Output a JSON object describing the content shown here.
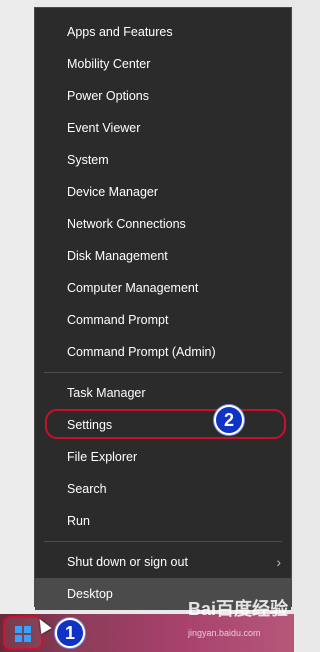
{
  "menu": {
    "items": [
      {
        "label": "Apps and Features"
      },
      {
        "label": "Mobility Center"
      },
      {
        "label": "Power Options"
      },
      {
        "label": "Event Viewer"
      },
      {
        "label": "System"
      },
      {
        "label": "Device Manager"
      },
      {
        "label": "Network Connections"
      },
      {
        "label": "Disk Management"
      },
      {
        "label": "Computer Management"
      },
      {
        "label": "Command Prompt"
      },
      {
        "label": "Command Prompt (Admin)"
      },
      {
        "label": "Task Manager"
      },
      {
        "label": "Settings"
      },
      {
        "label": "File Explorer"
      },
      {
        "label": "Search"
      },
      {
        "label": "Run"
      },
      {
        "label": "Shut down or sign out"
      },
      {
        "label": "Desktop"
      }
    ],
    "chevron": "›"
  },
  "annotations": {
    "step1": "1",
    "step2": "2"
  },
  "watermark": {
    "brand": "Bai百度经验",
    "url": "jingyan.baidu.com"
  },
  "colors": {
    "menu_bg": "#2b2b2b",
    "highlight": "#d01131",
    "badge": "#1033c7",
    "win_logo": "#33a3ff"
  },
  "icons": [
    "windows-logo-icon",
    "chevron-right-icon",
    "mouse-cursor-icon"
  ]
}
